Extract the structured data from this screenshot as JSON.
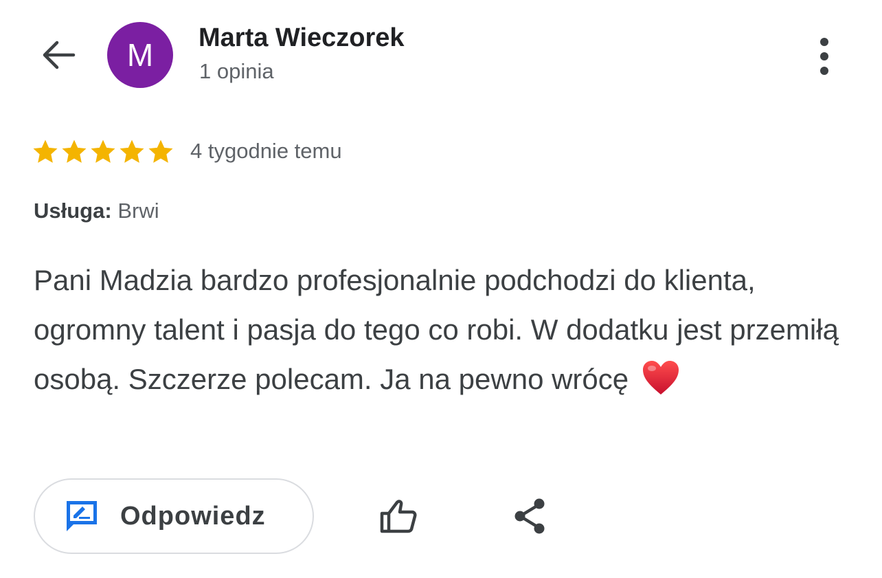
{
  "header": {
    "back_icon": "arrow-back-icon",
    "avatar_letter": "M",
    "avatar_color": "#7b1fa2",
    "name": "Marta Wieczorek",
    "review_count": "1 opinia",
    "menu_icon": "more-vert-icon"
  },
  "review": {
    "rating": 5,
    "rating_max": 5,
    "star_color": "#f4b400",
    "time_ago": "4 tygodnie temu",
    "service_label": "Usługa:",
    "service_value": "Brwi",
    "text": "Pani Madzia bardzo profesjonalnie podchodzi do klienta, ogromny talent i pasja do tego co robi. W dodatku jest przemiłą osobą. Szczerze polecam. Ja na pewno wrócę",
    "emoji_icon": "red-heart-icon"
  },
  "actions": {
    "reply_label": "Odpowiedz",
    "reply_icon": "rate-review-icon",
    "reply_icon_color": "#1a73e8",
    "like_icon": "thumb-up-icon",
    "share_icon": "share-icon"
  }
}
